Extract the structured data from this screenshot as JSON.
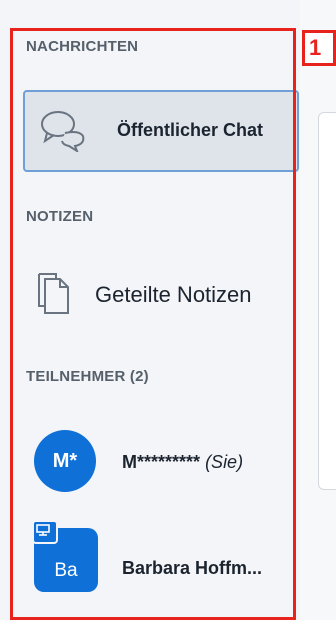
{
  "sidebar": {
    "messages_title": "NACHRICHTEN",
    "public_chat_label": "Öffentlicher Chat",
    "notes_title": "NOTIZEN",
    "shared_notes_label": "Geteilte Notizen",
    "participants_title": "TEILNEHMER (2)",
    "users": [
      {
        "avatar": "M*",
        "name": "M*********",
        "suffix": "(Sie)"
      },
      {
        "avatar": "Ba",
        "name": "Barbara Hoffm..."
      }
    ]
  },
  "annotation": {
    "step_number": "1"
  },
  "icons": {
    "chat": "speech-bubbles-icon",
    "notes": "document-stack-icon",
    "presenter": "presenter-badge-icon"
  },
  "colors": {
    "highlight": "#e8231d",
    "accent": "#0f70d7",
    "selected_bg": "#dfe4ea",
    "selected_border": "#6e9fd6"
  }
}
